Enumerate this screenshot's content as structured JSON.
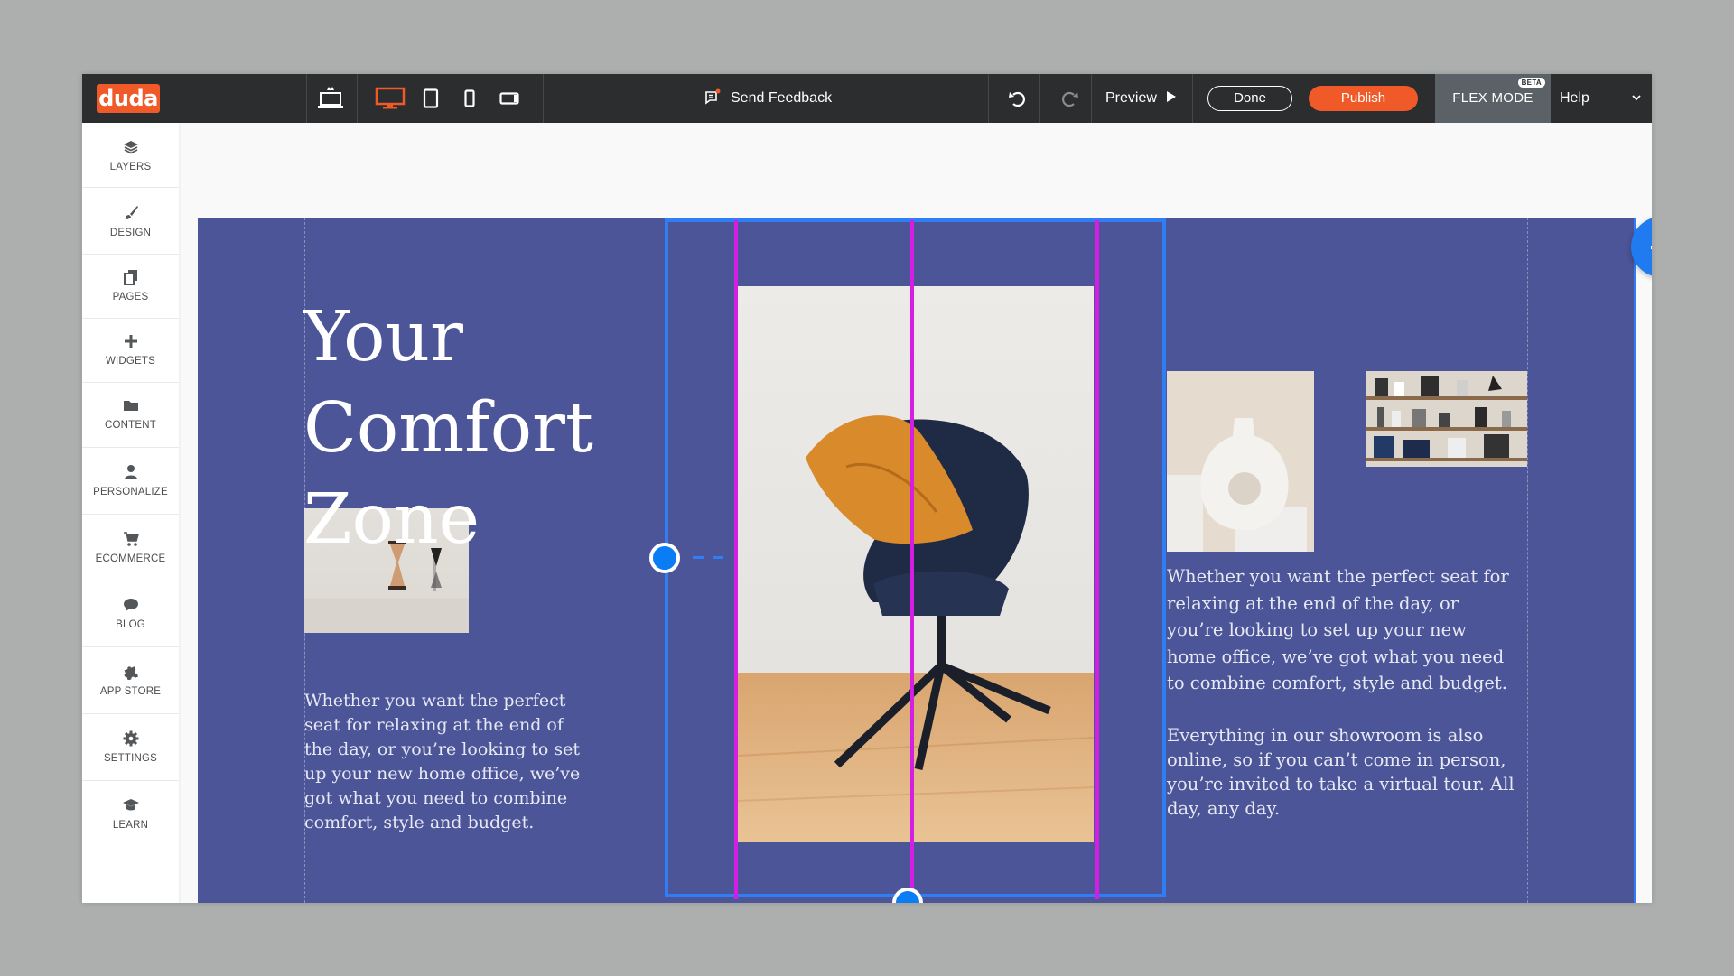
{
  "app": {
    "logo_text": "duda"
  },
  "toolbar": {
    "device_icons": [
      "laptop-crown-icon",
      "desktop-icon",
      "tablet-icon",
      "mobile-icon",
      "landscape-icon"
    ],
    "send_feedback": "Send Feedback",
    "preview": "Preview",
    "done": "Done",
    "publish": "Publish",
    "flex_mode": "FLEX MODE",
    "beta_badge": "BETA",
    "help": "Help"
  },
  "sidebar": {
    "items": [
      {
        "label": "LAYERS",
        "icon": "layers-icon"
      },
      {
        "label": "DESIGN",
        "icon": "brush-icon"
      },
      {
        "label": "PAGES",
        "icon": "pages-icon"
      },
      {
        "label": "WIDGETS",
        "icon": "plus-icon"
      },
      {
        "label": "CONTENT",
        "icon": "folder-icon"
      },
      {
        "label": "PERSONALIZE",
        "icon": "person-icon"
      },
      {
        "label": "ECOMMERCE",
        "icon": "cart-icon"
      },
      {
        "label": "BLOG",
        "icon": "speech-bubble-icon"
      },
      {
        "label": "APP STORE",
        "icon": "puzzle-icon"
      },
      {
        "label": "SETTINGS",
        "icon": "gear-icon"
      },
      {
        "label": "LEARN",
        "icon": "graduation-cap-icon"
      }
    ]
  },
  "section": {
    "title": "Your Comfort Zone",
    "left_paragraph": "Whether you want the perfect seat for relaxing at the end of the day, or you’re looking to set up your new home office, we’ve got what you need to combine comfort, style and budget.",
    "right_paragraph_1": "Whether you want the perfect seat for relaxing at the end of the day, or you’re looking to set up your new home office, we’ve got what you need to combine comfort, style and budget.",
    "right_paragraph_2": "Everything in our showroom is also online, so if you can’t come in person, you’re invited to take a virtual tour. All day, any day."
  },
  "colors": {
    "section_bg": "#4b5597",
    "publish": "#f05a28",
    "selection": "#2f7ef5",
    "grid_guides": "#d41ee3"
  }
}
